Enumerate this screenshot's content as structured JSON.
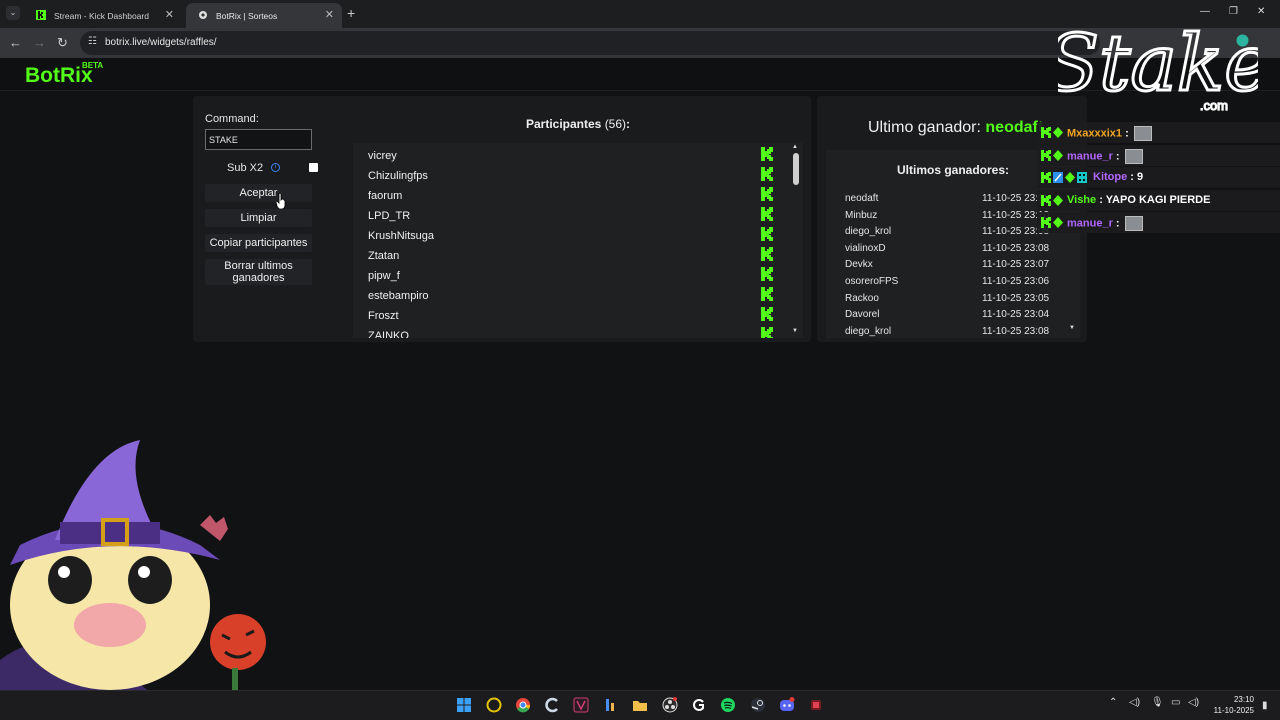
{
  "browser": {
    "tabs": [
      {
        "title": "Stream - Kick Dashboard",
        "active": false,
        "icon": "kick-icon"
      },
      {
        "title": "BotRix | Sorteos",
        "active": true,
        "icon": "botrix-icon"
      }
    ],
    "url": "botrix.live/widgets/raffles/"
  },
  "app": {
    "logo": "BotRix",
    "badge": "BETA",
    "accent": "#53fc18"
  },
  "controls": {
    "command_label": "Command:",
    "command_value": "STAKE",
    "sub_label": "Sub X2",
    "accept": "Aceptar",
    "clear": "Limpiar",
    "copy": "Copiar participantes",
    "clear_winners": "Borrar ultimos ganadores"
  },
  "participants": {
    "title": "Participantes",
    "count": "(56)",
    "colon": ":",
    "names": [
      "vicrey",
      "Chizulingfps",
      "faorum",
      "LPD_TR",
      "KrushNitsuga",
      "Ztatan",
      "pipw_f",
      "estebampiro",
      "Froszt",
      "ZAINKO"
    ]
  },
  "winners": {
    "last_label": "Ultimo ganador:",
    "last_name": "neodaft",
    "recent_title": "Ultimos ganadores:",
    "rows": [
      {
        "name": "neodaft",
        "time": "11-10-25 23:11"
      },
      {
        "name": "Minbuz",
        "time": "11-10-25 23:10"
      },
      {
        "name": "diego_krol",
        "time": "11-10-25 23:08"
      },
      {
        "name": "vialinoxD",
        "time": "11-10-25 23:08"
      },
      {
        "name": "Devkx",
        "time": "11-10-25 23:07"
      },
      {
        "name": "osoreroFPS",
        "time": "11-10-25 23:06"
      },
      {
        "name": "Rackoo",
        "time": "11-10-25 23:05"
      },
      {
        "name": "Davorel",
        "time": "11-10-25 23:04"
      },
      {
        "name": "diego_krol",
        "time": "11-10-25 23:08"
      }
    ]
  },
  "chat": [
    {
      "user": "Mxaxxxix1",
      "color": "#f5a623",
      "message": "",
      "emote": true
    },
    {
      "user": "manue_r",
      "color": "#b266ff",
      "message": "",
      "emote": true
    },
    {
      "user": "Kitope",
      "color": "#b266ff",
      "message": "9",
      "emote": false
    },
    {
      "user": "Vishe",
      "color": "#53fc18",
      "message": "YAPO KAGI PIERDE",
      "emote": false
    },
    {
      "user": "manue_r",
      "color": "#b266ff",
      "message": "",
      "emote": true
    }
  ],
  "watermark": {
    "brand": "Stake",
    "suffix": ".com"
  },
  "taskbar": {
    "time": "23:10",
    "date": "11-10-2025"
  }
}
